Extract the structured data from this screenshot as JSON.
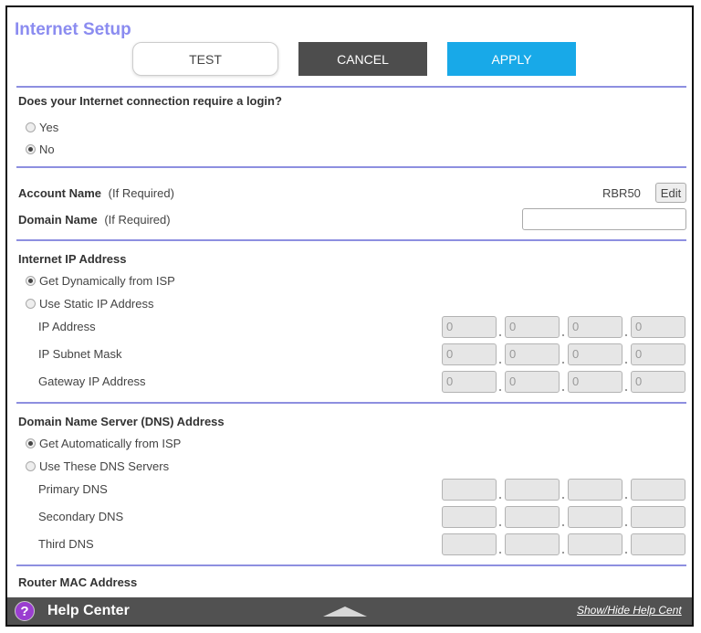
{
  "page": {
    "title": "Internet Setup"
  },
  "toolbar": {
    "test": "TEST",
    "cancel": "CANCEL",
    "apply": "APPLY"
  },
  "login_section": {
    "question": "Does your Internet connection require a login?",
    "yes": "Yes",
    "no": "No",
    "selected": "No"
  },
  "account": {
    "name_label": "Account Name",
    "name_hint": "(If Required)",
    "name_value": "RBR50",
    "edit": "Edit",
    "domain_label": "Domain Name",
    "domain_hint": "(If Required)",
    "domain_value": ""
  },
  "ip_section": {
    "title": "Internet IP Address",
    "dynamic": "Get Dynamically from ISP",
    "static": "Use Static IP Address",
    "selected": "Get Dynamically from ISP",
    "ip_label": "IP Address",
    "subnet_label": "IP Subnet Mask",
    "gateway_label": "Gateway IP Address",
    "ip": [
      "0",
      "0",
      "0",
      "0"
    ],
    "subnet": [
      "0",
      "0",
      "0",
      "0"
    ],
    "gateway": [
      "0",
      "0",
      "0",
      "0"
    ]
  },
  "dns_section": {
    "title": "Domain Name Server (DNS) Address",
    "auto": "Get Automatically from ISP",
    "manual": "Use These DNS Servers",
    "selected": "Get Automatically from ISP",
    "primary_label": "Primary DNS",
    "secondary_label": "Secondary DNS",
    "third_label": "Third DNS",
    "primary": [
      "",
      "",
      "",
      ""
    ],
    "secondary": [
      "",
      "",
      "",
      ""
    ],
    "third": [
      "",
      "",
      "",
      ""
    ]
  },
  "mac_section": {
    "title": "Router MAC Address"
  },
  "footer": {
    "help_icon": "?",
    "help_label": "Help Center",
    "show_hide": "Show/Hide Help Cent"
  },
  "colors": {
    "title": "#8b8cf0",
    "divider": "#8d8fe0",
    "cancel_bg": "#4d4d4d",
    "apply_bg": "#18a9e8",
    "footer_bg": "#515151",
    "help_icon_bg": "#9a3ed0"
  },
  "icons": {
    "help": "question-circle-icon",
    "toggle": "caret-up-icon"
  }
}
